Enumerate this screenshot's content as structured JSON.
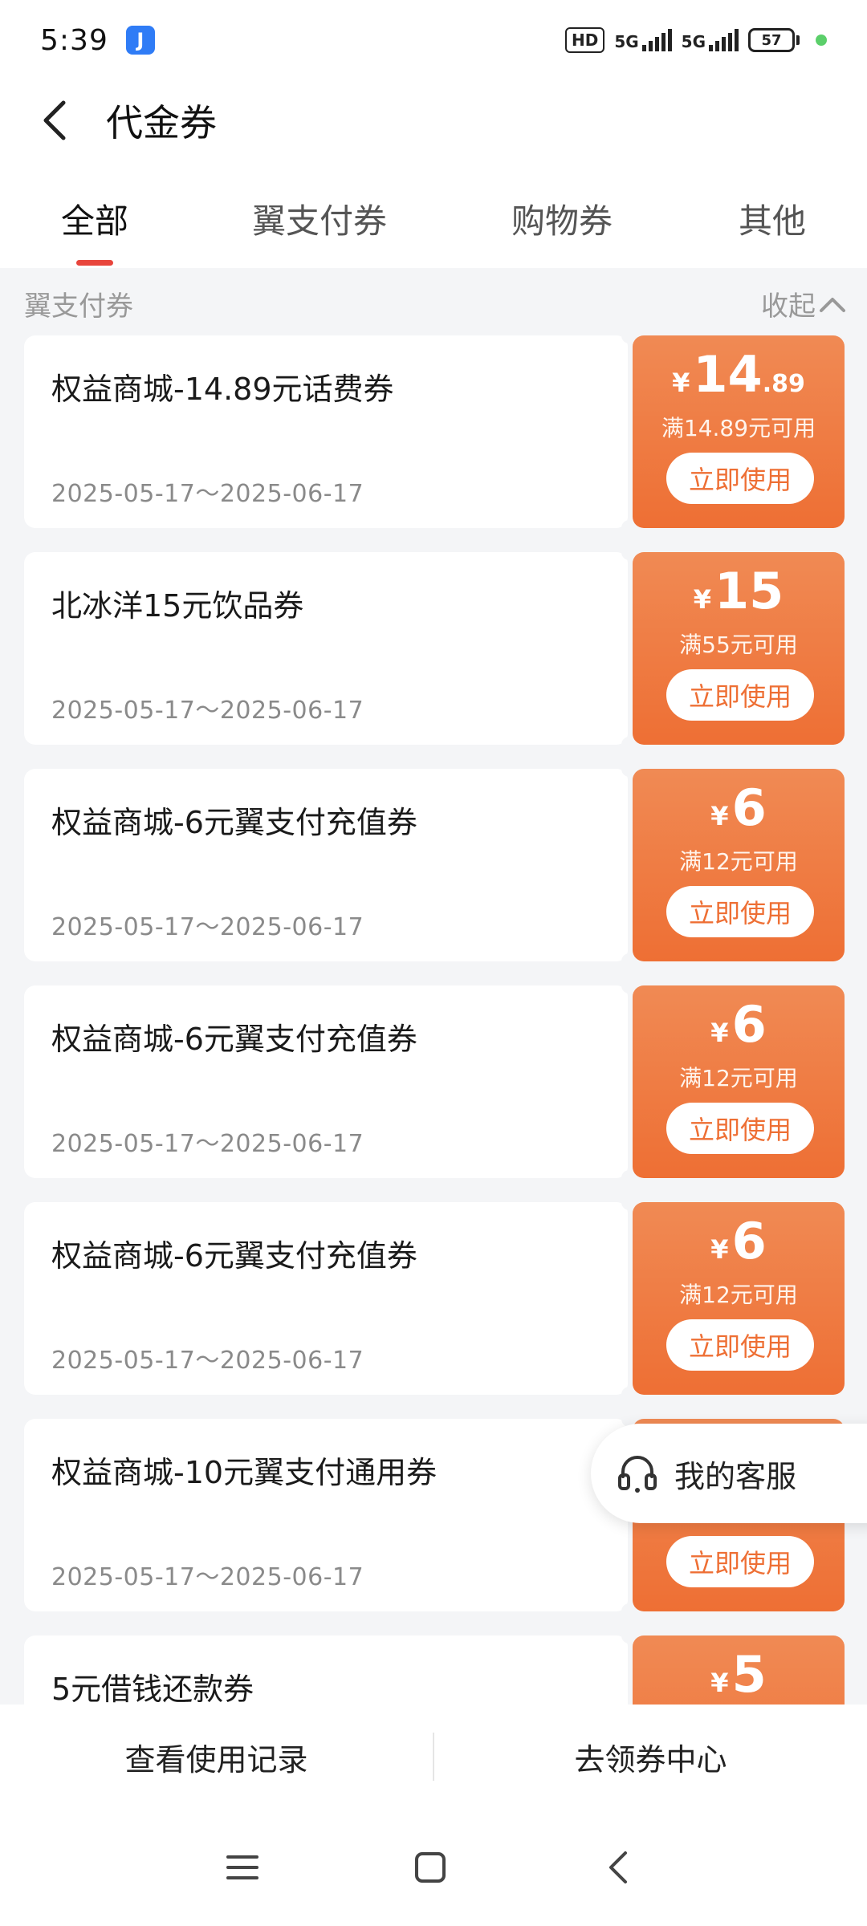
{
  "status_bar": {
    "time": "5:39",
    "app_badge_glyph": "J",
    "hd_label": "HD",
    "net1": "5G",
    "net2": "5G",
    "battery": "57"
  },
  "header": {
    "title": "代金券"
  },
  "tabs": [
    {
      "label": "全部",
      "active": true
    },
    {
      "label": "翼支付券",
      "active": false
    },
    {
      "label": "购物券",
      "active": false
    },
    {
      "label": "其他",
      "active": false
    }
  ],
  "section": {
    "title": "翼支付券",
    "collapse_label": "收起"
  },
  "coupons": [
    {
      "name": "权益商城-14.89元话费券",
      "date": "2025-05-17～2025-06-17",
      "currency": "¥",
      "amount_int": "14",
      "amount_dec": ".89",
      "threshold": "满14.89元可用",
      "button": "立即使用"
    },
    {
      "name": "北冰洋15元饮品券",
      "date": "2025-05-17～2025-06-17",
      "currency": "¥",
      "amount_int": "15",
      "amount_dec": "",
      "threshold": "满55元可用",
      "button": "立即使用"
    },
    {
      "name": "权益商城-6元翼支付充值券",
      "date": "2025-05-17～2025-06-17",
      "currency": "¥",
      "amount_int": "6",
      "amount_dec": "",
      "threshold": "满12元可用",
      "button": "立即使用"
    },
    {
      "name": "权益商城-6元翼支付充值券",
      "date": "2025-05-17～2025-06-17",
      "currency": "¥",
      "amount_int": "6",
      "amount_dec": "",
      "threshold": "满12元可用",
      "button": "立即使用"
    },
    {
      "name": "权益商城-6元翼支付充值券",
      "date": "2025-05-17～2025-06-17",
      "currency": "¥",
      "amount_int": "6",
      "amount_dec": "",
      "threshold": "满12元可用",
      "button": "立即使用"
    },
    {
      "name": "权益商城-10元翼支付通用券",
      "date": "2025-05-17～2025-06-17",
      "currency": "¥",
      "amount_int": "",
      "amount_dec": "",
      "threshold": "",
      "button": "立即使用"
    },
    {
      "name": "5元借钱还款券",
      "date": "",
      "currency": "¥",
      "amount_int": "5",
      "amount_dec": "",
      "threshold": "",
      "button": ""
    }
  ],
  "customer_service": {
    "label": "我的客服",
    "icon": "headset-icon"
  },
  "bottom_bar": {
    "left": "查看使用记录",
    "right": "去领券中心"
  },
  "colors": {
    "accent": "#ee6f34",
    "tab_indicator": "#e8453c",
    "background": "#f4f5f7"
  }
}
